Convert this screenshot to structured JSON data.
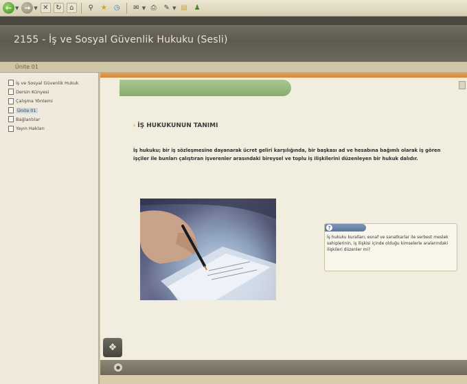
{
  "browser": {
    "toolbar_icons": [
      "back-icon",
      "forward-icon",
      "stop-icon",
      "refresh-icon",
      "home-icon",
      "search-icon",
      "favorites-icon",
      "history-icon",
      "mail-icon",
      "print-icon",
      "edit-icon",
      "folder-icon",
      "messenger-icon"
    ]
  },
  "header": {
    "title": "2155 - İş ve Sosyal Güvenlik Hukuku (Sesli)"
  },
  "breadcrumb": {
    "current": "Ünite 01"
  },
  "sidebar": {
    "items": [
      {
        "label": "İş ve Sosyal Güvenlik Hukuk"
      },
      {
        "label": "Dersin Künyesi"
      },
      {
        "label": "Çalışma Yöntemi"
      },
      {
        "label": "Ünite 01"
      },
      {
        "label": "Bağlantılar"
      },
      {
        "label": "Yayın Hakları"
      }
    ]
  },
  "content": {
    "page_title": "İŞ HUKUKUNUN TANIMI",
    "definition_term": "İş hukuku;",
    "definition_text": "bir iş sözleşmesine dayanarak ücret geliri karşılığında, bir başkası ad ve hesabına bağımlı olarak iş gören işçiler ile bunları çalıştıran işverenler arasındaki bireysel ve toplu iş ilişkilerini düzenleyen bir hukuk dalıdır.",
    "info_box": {
      "text": "İş hukuku kuralları; esnaf ve sanatkarlar ile serbest meslek sahiplerinin, iş ilişkisi içinde olduğu kimselerle aralarındaki ilişkileri düzenler mi?"
    }
  },
  "colors": {
    "accent_orange": "#d6882e",
    "ribbon_green": "#98ba7e",
    "header_gray": "#5e5a4f",
    "info_blue": "#5d7697"
  }
}
